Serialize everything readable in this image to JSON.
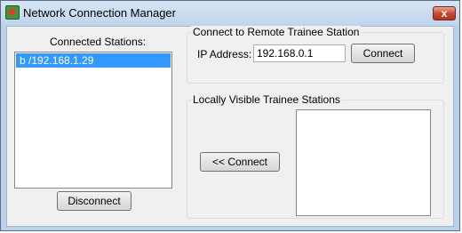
{
  "window": {
    "title": "Network Connection Manager",
    "close_glyph": "x"
  },
  "connected": {
    "label": "Connected Stations:",
    "items": [
      "b  /192.168.1.29"
    ],
    "disconnect_label": "Disconnect"
  },
  "remote": {
    "group_title": "Connect to Remote Trainee Station",
    "ip_label": "IP Address:",
    "ip_value": "192.168.0.1",
    "connect_label": "Connect"
  },
  "local": {
    "group_title": "Locally Visible Trainee Stations",
    "connect_label": "<< Connect",
    "items": []
  }
}
